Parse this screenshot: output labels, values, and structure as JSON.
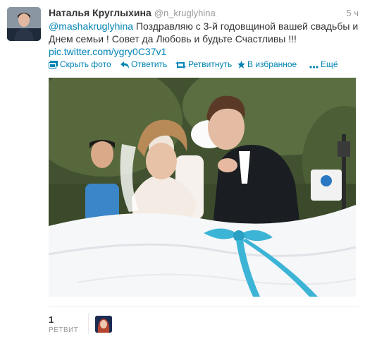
{
  "tweet": {
    "author": {
      "fullname": "Наталья Круглыхина",
      "username": "@n_kruglyhina"
    },
    "timestamp": "5 ч",
    "text": {
      "mention": "@mashakruglyhina",
      "body": " Поздравляю с 3-й годовщиной вашей свадьбы и Днем семьи ! Совет да Любовь и будьте Счастливы !!! ",
      "link": "pic.twitter.com/ygry0C37v1"
    },
    "actions": {
      "hide_photo": "Скрыть фото",
      "reply": "Ответить",
      "retweet": "Ретвитнуть",
      "favorite": "В избранное",
      "more": "Ещё"
    },
    "stats": {
      "retweet_count": "1",
      "retweet_label": "РЕТВИТ"
    }
  },
  "colors": {
    "link": "#0084b4",
    "muted": "#999999",
    "text": "#333333",
    "ribbon": "#3cb4d6"
  },
  "icons": [
    "media-icon",
    "reply-icon",
    "retweet-icon",
    "favorite-star-icon",
    "more-dots-icon"
  ]
}
